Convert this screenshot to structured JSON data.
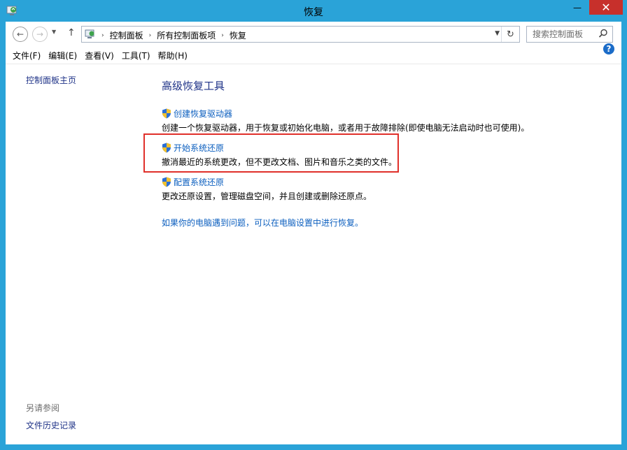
{
  "window": {
    "title": "恢复"
  },
  "titlebar_buttons": {
    "minimize": "—",
    "maximize": "□",
    "close": "✕"
  },
  "address": {
    "crumbs": [
      "控制面板",
      "所有控制面板项",
      "恢复"
    ],
    "separator": "›"
  },
  "search": {
    "placeholder": "搜索控制面板"
  },
  "menu": {
    "file": "文件(F)",
    "edit": "编辑(E)",
    "view": "查看(V)",
    "tools": "工具(T)",
    "help": "帮助(H)"
  },
  "sidebar": {
    "home": "控制面板主页",
    "see_also": "另请参阅",
    "file_history": "文件历史记录"
  },
  "main": {
    "title": "高级恢复工具",
    "tasks": [
      {
        "link": "创建恢复驱动器",
        "desc": "创建一个恢复驱动器，用于恢复或初始化电脑，或者用于故障排除(即使电脑无法启动时也可使用)。"
      },
      {
        "link": "开始系统还原",
        "desc": "撤消最近的系统更改，但不更改文档、图片和音乐之类的文件。"
      },
      {
        "link": "配置系统还原",
        "desc": "更改还原设置，管理磁盘空间，并且创建或删除还原点。"
      }
    ],
    "pc_settings_link": "如果你的电脑遇到问题，可以在电脑设置中进行恢复。"
  },
  "icons": {
    "shield": "uac-shield-icon",
    "help": "help-icon",
    "back": "back-arrow-icon",
    "forward": "forward-arrow-icon",
    "up": "up-arrow-icon",
    "refresh": "refresh-icon",
    "search": "search-icon"
  },
  "colors": {
    "frame": "#2aa3d8",
    "close_button": "#c7302b",
    "link": "#0c5fbf",
    "nav_link": "#1e3287",
    "highlight_box": "#e0302a"
  }
}
